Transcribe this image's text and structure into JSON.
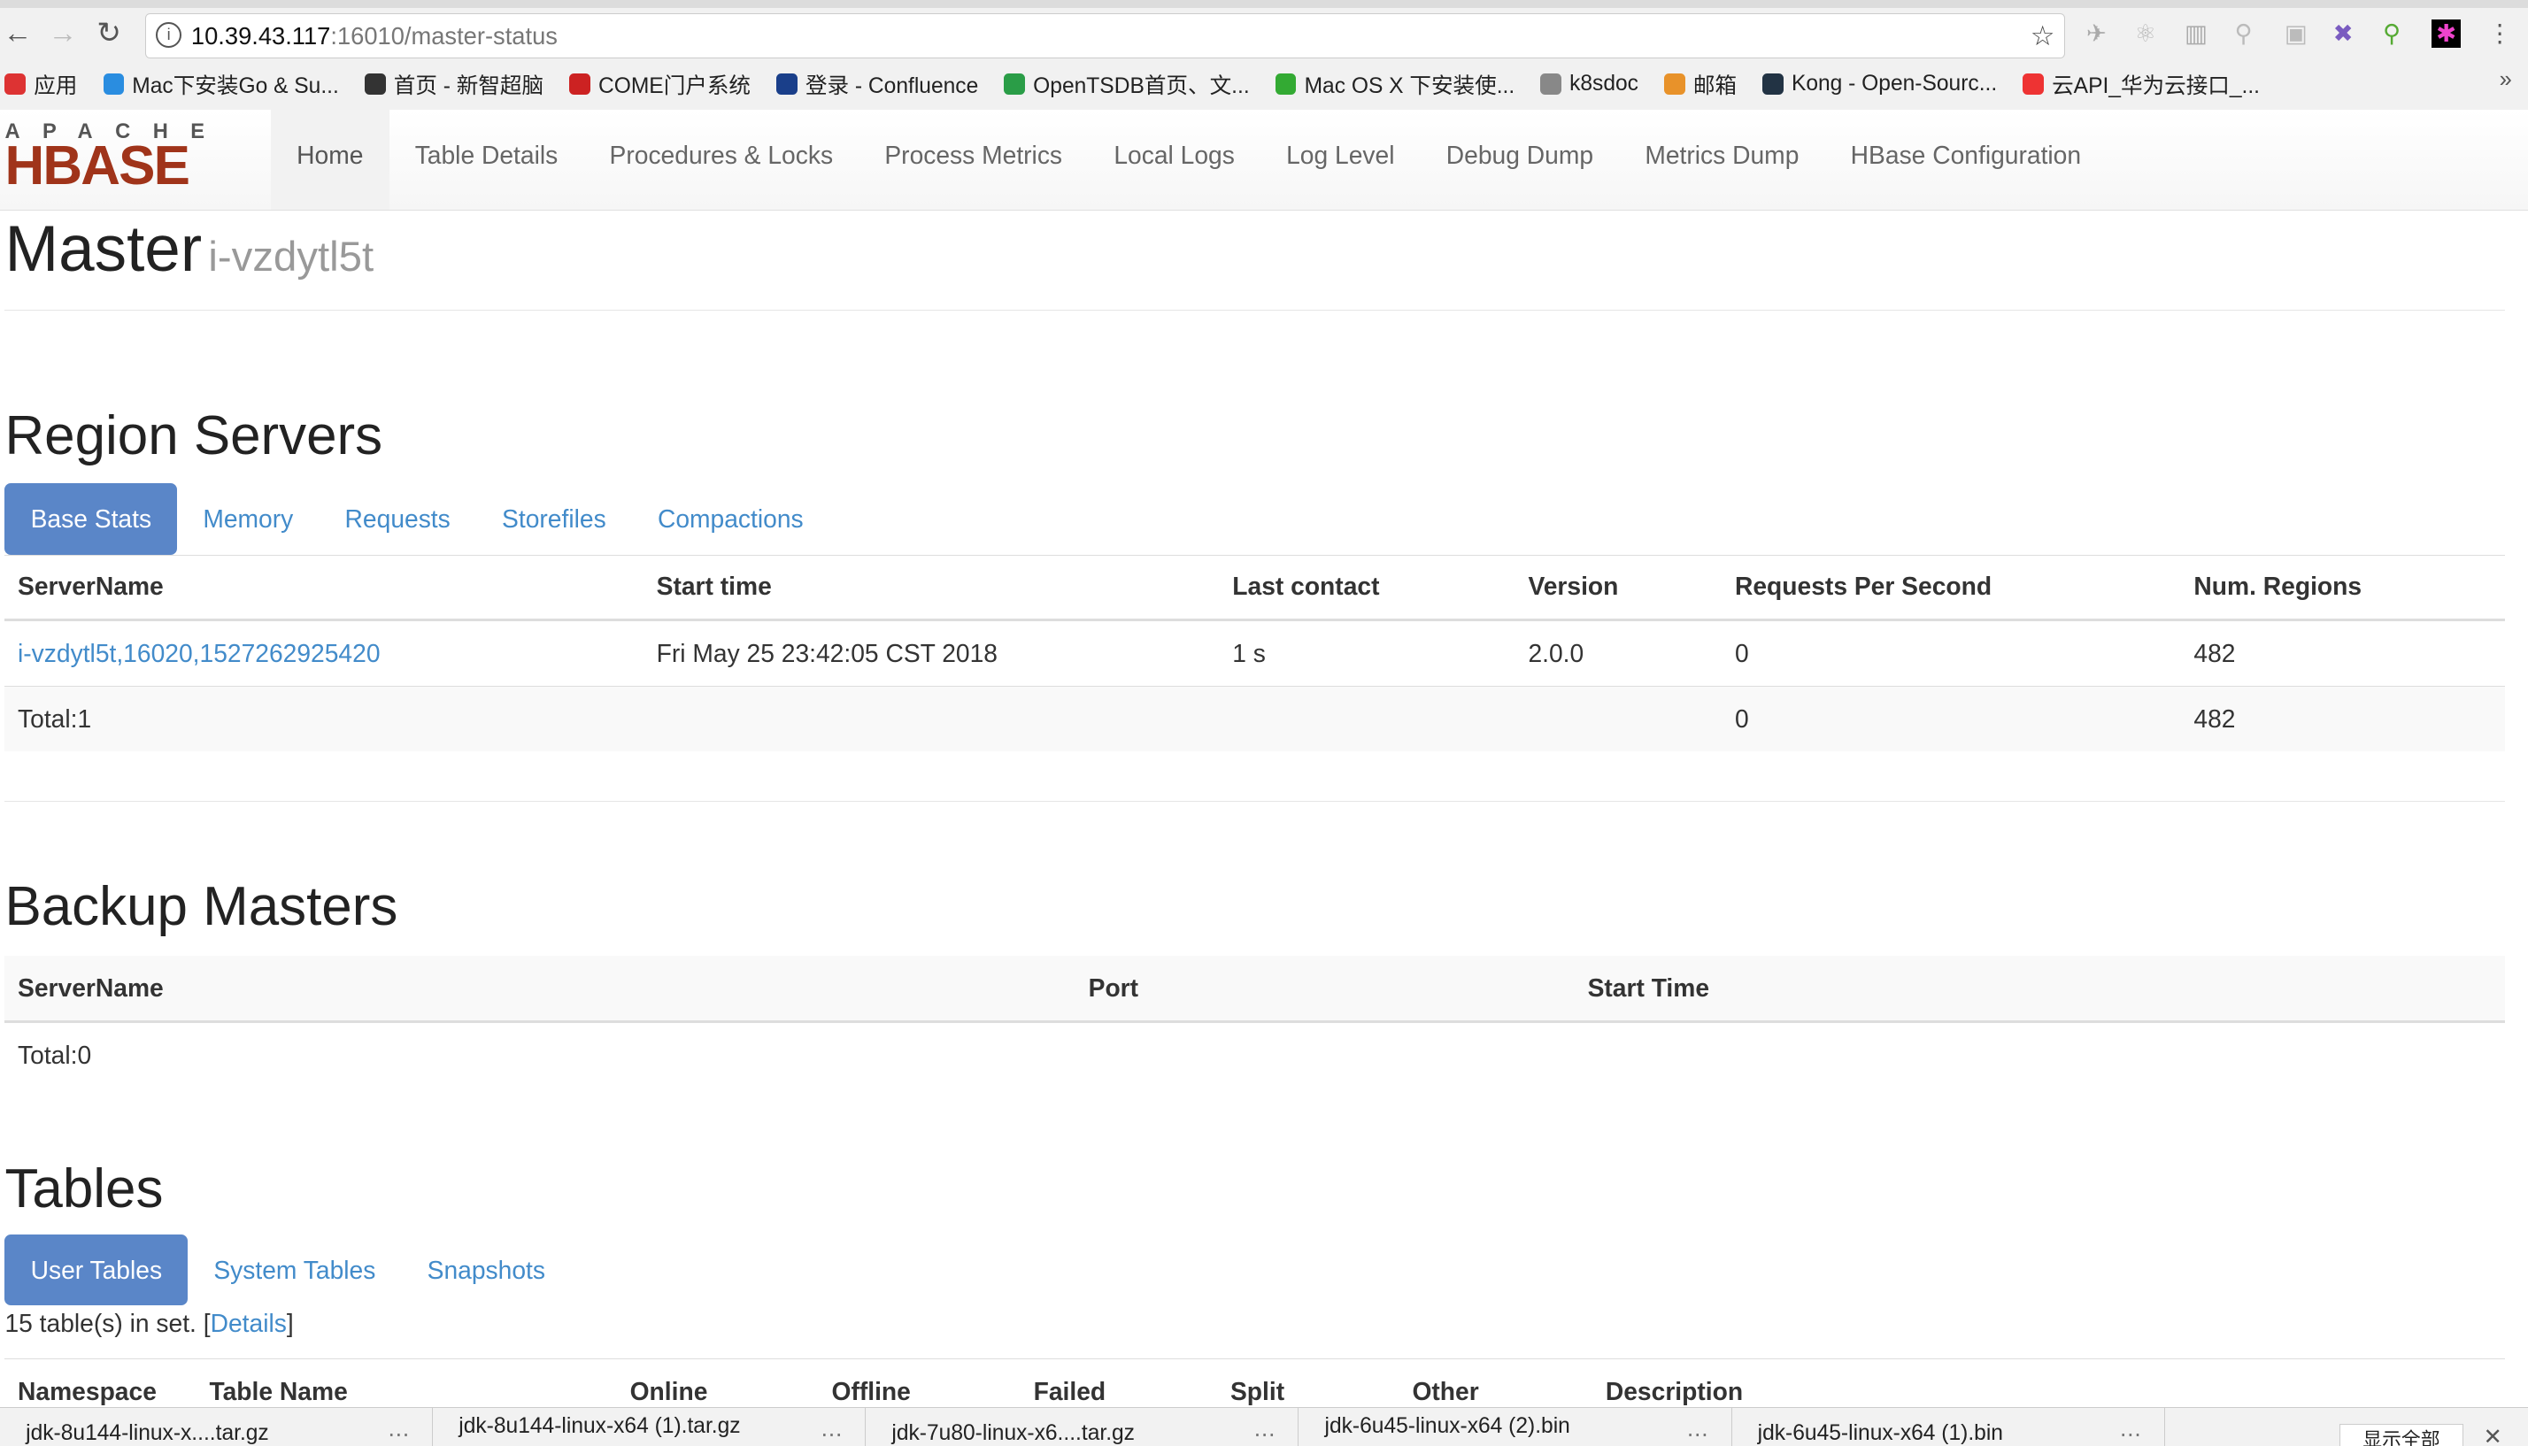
{
  "browser": {
    "url_host": "10.39.43.117",
    "url_path": ":16010/master-status",
    "bookmarks": [
      "应用",
      "Mac下安装Go & Su...",
      "首页 - 新智超脑",
      "COME门户系统",
      "登录 - Confluence",
      "OpenTSDB首页、文...",
      "Mac OS X 下安装使...",
      "k8sdoc",
      "邮箱",
      "Kong - Open-Sourc...",
      "云API_华为云接口_..."
    ],
    "bookmark_colors": [
      "#d33",
      "#2a8de0",
      "#333",
      "#c22",
      "#1a3f8a",
      "#2a9d47",
      "#3a3",
      "#888",
      "#e8922a",
      "#234",
      "#e33"
    ]
  },
  "nav": {
    "brand_top": "APACHE",
    "brand": "HBASE",
    "links": [
      "Home",
      "Table Details",
      "Procedures & Locks",
      "Process Metrics",
      "Local Logs",
      "Log Level",
      "Debug Dump",
      "Metrics Dump",
      "HBase Configuration"
    ]
  },
  "header": {
    "title": "Master",
    "host": "i-vzdytl5t"
  },
  "region_servers": {
    "title": "Region Servers",
    "tabs": [
      "Base Stats",
      "Memory",
      "Requests",
      "Storefiles",
      "Compactions"
    ],
    "columns": [
      "ServerName",
      "Start time",
      "Last contact",
      "Version",
      "Requests Per Second",
      "Num. Regions"
    ],
    "rows": [
      [
        "i-vzdytl5t,16020,1527262925420",
        "Fri May 25 23:42:05 CST 2018",
        "1 s",
        "2.0.0",
        "0",
        "482"
      ]
    ],
    "total": {
      "label": "Total:1",
      "requests": "0",
      "regions": "482"
    }
  },
  "backup_masters": {
    "title": "Backup Masters",
    "columns": [
      "ServerName",
      "Port",
      "Start Time"
    ],
    "total": "Total:0"
  },
  "tables": {
    "title": "Tables",
    "tabs": [
      "User Tables",
      "System Tables",
      "Snapshots"
    ],
    "count_text": "15 table(s) in set. [",
    "details": "Details",
    "count_end": "]",
    "columns": [
      "Namespace",
      "Table Name",
      "Online",
      "Offline",
      "Failed",
      "Split",
      "Other",
      "Description"
    ]
  },
  "downloads": {
    "items": [
      "jdk-8u144-linux-x....tar.gz",
      "jdk-8u144-linux-x64 (1).tar.gz",
      "jdk-7u80-linux-x6....tar.gz",
      "jdk-6u45-linux-x64 (2).bin",
      "jdk-6u45-linux-x64 (1).bin"
    ],
    "show_all": "显示全部"
  },
  "colors": {
    "accent": "#428bca",
    "active_tab": "#5a86c8",
    "brand": "#a0341a"
  }
}
